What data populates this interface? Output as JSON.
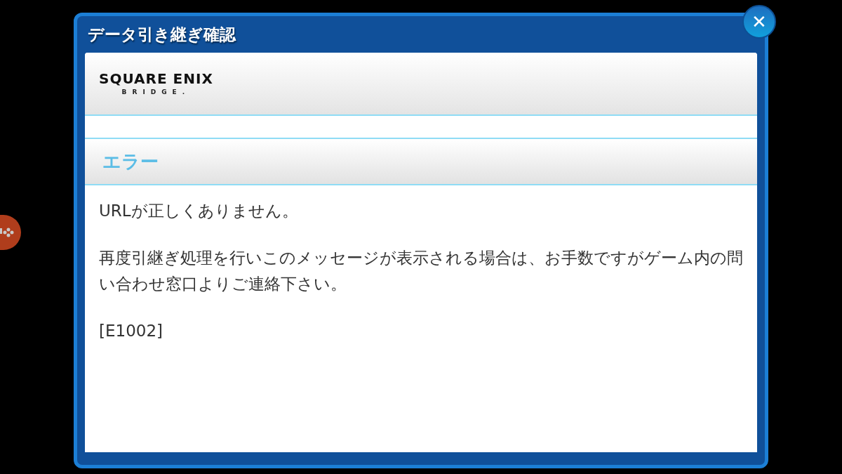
{
  "dialog": {
    "title": "データ引き継ぎ確認",
    "close_label": "✕"
  },
  "logo": {
    "name": "SQUARE ENIX",
    "sub": "BRIDGE."
  },
  "section": {
    "title": "エラー"
  },
  "paragraphs": [
    "URLが正しくありません。",
    "再度引継ぎ処理を行いこのメッセージが表示される場合は、お手数ですがゲーム内の問い合わせ窓口よりご連絡下さい。",
    "[E1002]"
  ]
}
